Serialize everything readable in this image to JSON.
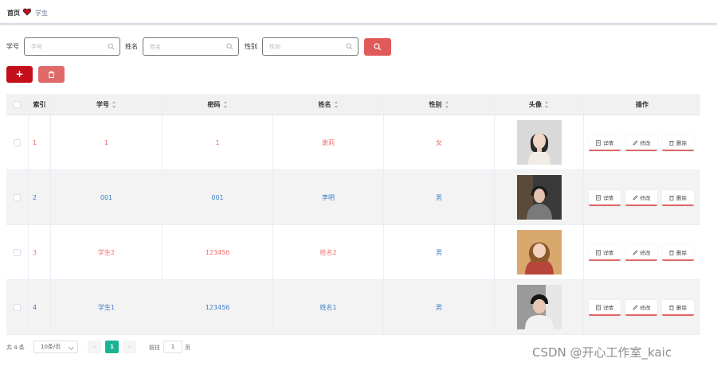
{
  "breadcrumb": {
    "home": "首页",
    "current": "学生"
  },
  "search": {
    "student_no_label": "学号",
    "student_no_placeholder": "学号",
    "name_label": "姓名",
    "name_placeholder": "姓名",
    "gender_label": "性别",
    "gender_placeholder": "性别"
  },
  "toolbar": {
    "add_label": "+"
  },
  "table": {
    "headers": {
      "index": "索引",
      "student_no": "学号",
      "password": "密码",
      "name": "姓名",
      "gender": "性别",
      "avatar": "头像",
      "actions": "操作"
    },
    "rows": [
      {
        "index": "1",
        "student_no": "1",
        "password": "1",
        "name": "谢莉",
        "gender": "女",
        "color": "red"
      },
      {
        "index": "2",
        "student_no": "001",
        "password": "001",
        "name": "李明",
        "gender": "男",
        "color": "blue"
      },
      {
        "index": "3",
        "student_no": "学生2",
        "password": "123456",
        "name": "姓名2",
        "gender": "男",
        "color": "red"
      },
      {
        "index": "4",
        "student_no": "学生1",
        "password": "123456",
        "name": "姓名1",
        "gender": "男",
        "color": "blue"
      }
    ],
    "actions": {
      "detail": "详情",
      "edit": "修改",
      "delete": "删除"
    }
  },
  "pagination": {
    "total": "共 4 条",
    "page_size": "10条/页",
    "prev": "‹",
    "current": "1",
    "next": "›",
    "goto": "前往",
    "goto_value": "1",
    "page_suffix": "页"
  },
  "watermark": "CSDN @开心工作室_kaic",
  "colors": {
    "accent_red": "#e05a5a",
    "add_red": "#c40f1a",
    "page_green": "#1ab394",
    "text_red": "#f56c6c",
    "text_blue": "#3e7ec4"
  }
}
